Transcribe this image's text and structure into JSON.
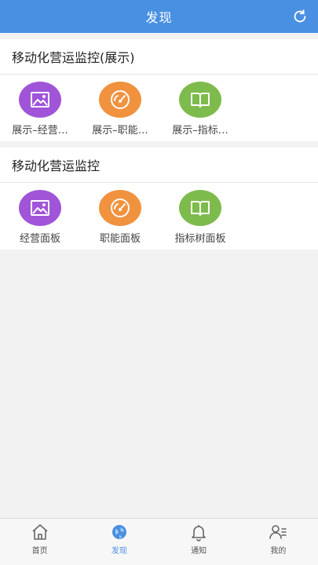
{
  "header": {
    "title": "发现",
    "refresh_icon": "refresh-icon"
  },
  "sections": [
    {
      "title": "移动化营运监控(展示)",
      "items": [
        {
          "label": "展示–经营…",
          "icon": "image-icon",
          "color": "#a054d8"
        },
        {
          "label": "展示–职能…",
          "icon": "gauge-icon",
          "color": "#f0923e"
        },
        {
          "label": "展示–指标…",
          "icon": "book-icon",
          "color": "#7dbb4c"
        }
      ]
    },
    {
      "title": "移动化营运监控",
      "items": [
        {
          "label": "经营面板",
          "icon": "image-icon",
          "color": "#a054d8"
        },
        {
          "label": "职能面板",
          "icon": "gauge-icon",
          "color": "#f0923e"
        },
        {
          "label": "指标树面板",
          "icon": "book-icon",
          "color": "#7dbb4c"
        }
      ]
    }
  ],
  "tabbar": {
    "tabs": [
      {
        "label": "首页",
        "icon": "home-icon",
        "active": false
      },
      {
        "label": "发现",
        "icon": "globe-icon",
        "active": true
      },
      {
        "label": "通知",
        "icon": "bell-icon",
        "active": false
      },
      {
        "label": "我的",
        "icon": "user-icon",
        "active": false
      }
    ]
  },
  "colors": {
    "accent": "#4a90e2"
  }
}
